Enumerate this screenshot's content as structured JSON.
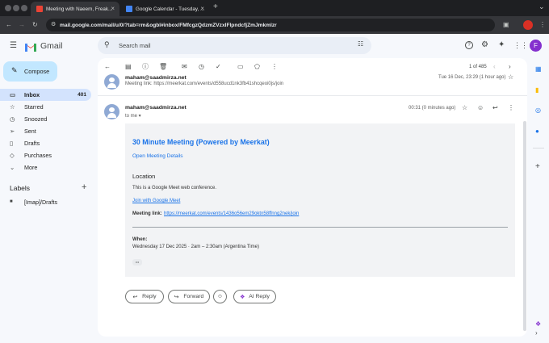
{
  "browser": {
    "tabs": [
      {
        "title": "Meeting with Naeem, Freak...",
        "active": true
      },
      {
        "title": "Google Calendar - Tuesday, ...",
        "active": false
      }
    ],
    "new_tab": "+",
    "url": "mail.google.com/mail/u/0/?tab=rm&ogbl#inbox/FMfcgzQdzmZVzxlFlpndcfjZmJmkmlzr",
    "profile_letter": "F",
    "window_menu": "⌄"
  },
  "gmail": {
    "logo_text": "Gmail",
    "search_placeholder": "Search mail",
    "avatar_letter": "F",
    "compose": "Compose",
    "nav": [
      {
        "label": "Inbox",
        "icon": "inbox-icon",
        "count": "401",
        "active": true
      },
      {
        "label": "Starred",
        "icon": "star-icon",
        "count": "",
        "active": false
      },
      {
        "label": "Snoozed",
        "icon": "clock-icon",
        "count": "",
        "active": false
      },
      {
        "label": "Sent",
        "icon": "send-icon",
        "count": "",
        "active": false
      },
      {
        "label": "Drafts",
        "icon": "draft-icon",
        "count": "",
        "active": false
      },
      {
        "label": "Purchases",
        "icon": "tag-icon",
        "count": "",
        "active": false
      },
      {
        "label": "More",
        "icon": "chevron-down-icon",
        "count": "",
        "active": false
      }
    ],
    "labels_heading": "Labels",
    "labels_add": "+",
    "labels": [
      {
        "label": "[Imap]/Drafts",
        "icon": "label-icon"
      }
    ],
    "toolbar": {
      "pagination": "1 of 485"
    },
    "messages": [
      {
        "from": "maham@saadmirza.net",
        "snippet": "Meeting link: https://meerkat.com/events/d558ucd1nk3fb41shcqeoi0js/join",
        "time": "Tue 16 Dec, 23:29 (1 hour ago)"
      },
      {
        "from": "maham@saadmirza.net",
        "to": "to me",
        "time": "00:31 (0 minutes ago)"
      }
    ],
    "email": {
      "title": "30 Minute Meeting (Powered by Meerkat)",
      "open_details": "Open Meeting Details",
      "location_heading": "Location",
      "location_text": "This is a Google Meet web conference.",
      "join_link": "Join with Google Meet",
      "meeting_link_label": "Meeting link:",
      "meeting_link": "https://meerkat.com/events/1436o56em29oktn58ffnng2nek/join",
      "when_label": "When:",
      "when_value": "Wednesday 17 Dec 2025 · 2am – 2:30am (Argentina Time)",
      "ellipsis": "•••"
    },
    "actions": {
      "reply": "Reply",
      "forward": "Forward",
      "ai_reply": "AI Reply"
    }
  },
  "colors": {
    "accent": "#0b57d0",
    "compose_bg": "#c2e7ff",
    "nav_active": "#d3e3fd",
    "title_blue": "#1a73e8",
    "profile": "#8430ce"
  }
}
